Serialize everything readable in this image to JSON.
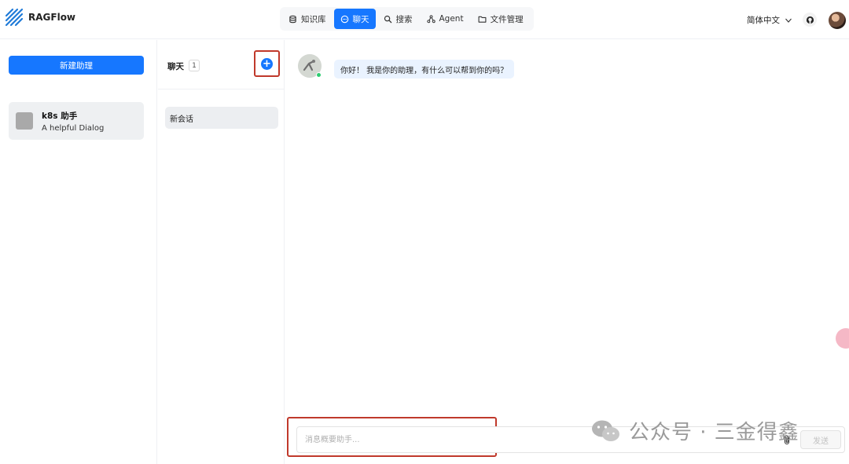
{
  "app": {
    "title": "RAGFlow"
  },
  "nav": {
    "items": [
      {
        "label": "知识库",
        "icon": "database-icon",
        "active": false
      },
      {
        "label": "聊天",
        "icon": "chat-icon",
        "active": true
      },
      {
        "label": "搜索",
        "icon": "search-icon",
        "active": false
      },
      {
        "label": "Agent",
        "icon": "agent-icon",
        "active": false
      },
      {
        "label": "文件管理",
        "icon": "folder-icon",
        "active": false
      }
    ]
  },
  "header": {
    "language": "简体中文"
  },
  "sidebar": {
    "new_assistant_label": "新建助理",
    "assistants": [
      {
        "name": "k8s 助手",
        "description": "A helpful Dialog"
      }
    ]
  },
  "conversations": {
    "title": "聊天",
    "count": "1",
    "items": [
      {
        "label": "新会话"
      }
    ]
  },
  "chat": {
    "greeting": "你好！ 我是你的助理，有什么可以帮到你的吗？",
    "input_placeholder": "消息概要助手...",
    "send_label": "发送"
  },
  "watermark": {
    "text": "公众号 · 三金得鑫"
  },
  "colors": {
    "primary": "#1677ff",
    "highlight_border": "#c0392b",
    "bubble_bg": "#eaf3ff"
  }
}
